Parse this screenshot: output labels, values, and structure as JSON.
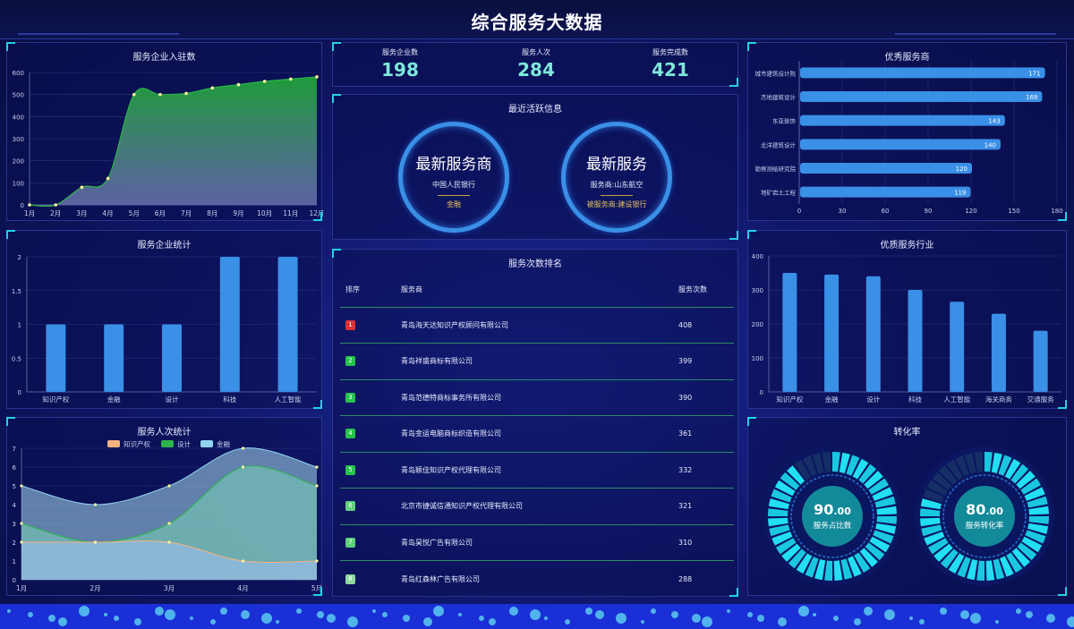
{
  "header": {
    "title": "综合服务大数据"
  },
  "colors": {
    "accent": "#22d3e6",
    "area_green": "#1e9b3a",
    "bar_blue": "#3a8fe6",
    "stat_value": "#7ee8d8",
    "rank_first": "#e03030",
    "rank_green": "#26c44a"
  },
  "panels": {
    "entry": {
      "title": "服务企业入驻数"
    },
    "enterprise_stats": {
      "title": "服务企业统计"
    },
    "visits": {
      "title": "服务人次统计"
    },
    "active": {
      "title": "最近活跃信息"
    },
    "ranking": {
      "title": "服务次数排名"
    },
    "providers": {
      "title": "优秀服务商"
    },
    "industries": {
      "title": "优质服务行业"
    },
    "conversion": {
      "title": "转化率"
    }
  },
  "stats": [
    {
      "label": "服务企业数",
      "value": "198"
    },
    {
      "label": "服务人次",
      "value": "284"
    },
    {
      "label": "服务完成数",
      "value": "421"
    }
  ],
  "active": [
    {
      "heading": "最新服务商",
      "line1": "中国人民银行",
      "line2": "金融"
    },
    {
      "heading": "最新服务",
      "line1": "服务商:山东航空",
      "line2": "被服务商:建设银行"
    }
  ],
  "ranking": {
    "headers": [
      "排序",
      "服务商",
      "服务次数"
    ],
    "rows": [
      {
        "rank": "1",
        "name": "青岛海天达知识产权顾问有限公司",
        "count": "408"
      },
      {
        "rank": "2",
        "name": "青岛祥盛商标有限公司",
        "count": "399"
      },
      {
        "rank": "3",
        "name": "青岛范德特商标事务所有限公司",
        "count": "390"
      },
      {
        "rank": "4",
        "name": "青岛金运电脑商标织造有限公司",
        "count": "361"
      },
      {
        "rank": "5",
        "name": "青岛颖佳知识产权代理有限公司",
        "count": "332"
      },
      {
        "rank": "6",
        "name": "北京市捷诚信通知识产权代理有限公司",
        "count": "321"
      },
      {
        "rank": "7",
        "name": "青岛昊悦广告有限公司",
        "count": "310"
      },
      {
        "rank": "8",
        "name": "青岛红森林广告有限公司",
        "count": "288"
      }
    ]
  },
  "conversion": [
    {
      "value": "90",
      "decimal": ".00",
      "label": "服务占比数",
      "percent": 90
    },
    {
      "value": "80",
      "decimal": ".00",
      "label": "服务转化率",
      "percent": 80
    }
  ],
  "chart_data": [
    {
      "id": "entry",
      "type": "area",
      "categories": [
        "1月",
        "2月",
        "3月",
        "4月",
        "5月",
        "6月",
        "7月",
        "8月",
        "9月",
        "10月",
        "11月",
        "12月"
      ],
      "values": [
        0,
        0,
        80,
        120,
        500,
        500,
        505,
        530,
        545,
        560,
        570,
        580
      ],
      "yticks": [
        "0",
        "100",
        "200",
        "300",
        "400",
        "500",
        "600"
      ],
      "ylim": [
        0,
        600
      ]
    },
    {
      "id": "enterprise_stats",
      "type": "bar",
      "categories": [
        "知识产权",
        "金融",
        "设计",
        "科技",
        "人工智能"
      ],
      "values": [
        1,
        1,
        1,
        2,
        2
      ],
      "yticks": [
        "0",
        "0.5",
        "1",
        "1.5",
        "2"
      ],
      "ylim": [
        0,
        2
      ]
    },
    {
      "id": "visits",
      "type": "area",
      "categories": [
        "1月",
        "2月",
        "3月",
        "4月",
        "5月"
      ],
      "series": [
        {
          "name": "知识产权",
          "values": [
            2,
            2,
            2,
            1,
            1
          ],
          "color": "#f4b27c"
        },
        {
          "name": "设计",
          "values": [
            3,
            2,
            3,
            6,
            5
          ],
          "color": "#2bb54a"
        },
        {
          "name": "金融",
          "values": [
            5,
            4,
            5,
            7,
            6
          ],
          "color": "#8fd4f0"
        }
      ],
      "yticks": [
        "0",
        "1",
        "2",
        "3",
        "4",
        "5",
        "6",
        "7"
      ],
      "ylim": [
        0,
        7
      ]
    },
    {
      "id": "providers",
      "type": "bar",
      "categories": [
        "城市建筑设计院",
        "杰地建筑设计",
        "东亚装饰",
        "北洋建筑设计",
        "勘察测绘研究院",
        "地矿岩土工程"
      ],
      "values": [
        171,
        169,
        143,
        140,
        120,
        119
      ],
      "xticks": [
        "0",
        "30",
        "60",
        "90",
        "120",
        "150",
        "180"
      ],
      "xlim": [
        0,
        180
      ]
    },
    {
      "id": "industries",
      "type": "bar",
      "categories": [
        "知识产权",
        "金融",
        "设计",
        "科技",
        "人工智能",
        "海关商务",
        "交通服务"
      ],
      "values": [
        350,
        345,
        340,
        300,
        265,
        230,
        180
      ],
      "yticks": [
        "0",
        "100",
        "200",
        "300",
        "400"
      ],
      "ylim": [
        0,
        400
      ]
    }
  ]
}
